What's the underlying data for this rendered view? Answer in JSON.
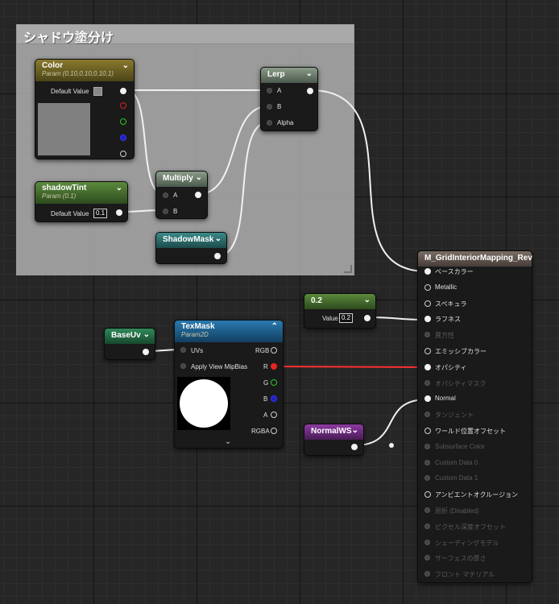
{
  "comment_box": {
    "title": "シャドウ塗分け"
  },
  "color_node": {
    "title": "Color",
    "subtitle": "Param (0.10,0.10,0.10,1)",
    "default_label": "Default Value"
  },
  "shadowtint_node": {
    "title": "shadowTint",
    "subtitle": "Param (0.1)",
    "default_label": "Default Value",
    "default_value": "0.1"
  },
  "multiply_node": {
    "title": "Multiply",
    "pin_a": "A",
    "pin_b": "B"
  },
  "shadowmask_node": {
    "title": "ShadowMask"
  },
  "lerp_node": {
    "title": "Lerp",
    "pin_a": "A",
    "pin_b": "B",
    "pin_alpha": "Alpha"
  },
  "constant_node": {
    "title": "0.2",
    "value_label": "Value",
    "value": "0.2"
  },
  "baseuv_node": {
    "title": "BaseUv"
  },
  "texmask_node": {
    "title": "TexMask",
    "subtitle": "Param2D",
    "uvs": "UVs",
    "mip": "Apply View MipBias",
    "rgb": "RGB",
    "r": "R",
    "g": "G",
    "b": "B",
    "a": "A",
    "rgba": "RGBA"
  },
  "normalws_node": {
    "title": "NormalWS"
  },
  "material_node": {
    "title": "M_GridInteriorMapping_Rev",
    "pins": [
      "ベースカラー",
      "Metallic",
      "スペキュラ",
      "ラフネス",
      "異方性",
      "エミッシブカラー",
      "オパシティ",
      "オパシティマスク",
      "Normal",
      "タンジェント",
      "ワールド位置オフセット",
      "Subsurface Color",
      "Custom Data 0",
      "Custom Data 1",
      "アンビエントオクルージョン",
      "屈折 (Disabled)",
      "ピクセル深度オフセット",
      "シェーディングモデル",
      "サーフェスの厚さ",
      "フロント マテリアル"
    ]
  },
  "colors": {
    "wire": "#f0f0f0",
    "red_wire": "#ff3030",
    "comment_bg": "#bcbcbc",
    "param_vector_header": "#8a7a2e",
    "param_scalar_header": "#5b8a3c",
    "texture_header": "#2a7ab0",
    "function_header": "#8d3aa3",
    "material_header": "#7a6e66"
  }
}
